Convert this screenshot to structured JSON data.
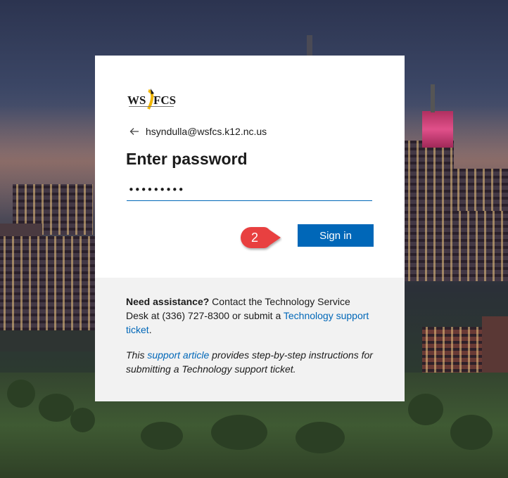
{
  "account": {
    "back_label": "Back",
    "email": "hsyndulla@wsfcs.k12.nc.us"
  },
  "logo": {
    "text": "WSFCS"
  },
  "title": "Enter password",
  "password": {
    "masked_value": "•••••••••"
  },
  "sign_in_label": "Sign in",
  "step_badge": "2",
  "assistance": {
    "bold": "Need assistance?",
    "text": " Contact the Technology Service Desk at (336) 727-8300 or submit a ",
    "link": "Technology support ticket",
    "end": "."
  },
  "note": {
    "prefix": "This ",
    "link": "support article",
    "suffix": " provides step-by-step instructions for submitting a Technology support ticket."
  },
  "colors": {
    "accent": "#0067b8",
    "badge": "#e84040",
    "footer_bg": "#f2f2f2"
  }
}
